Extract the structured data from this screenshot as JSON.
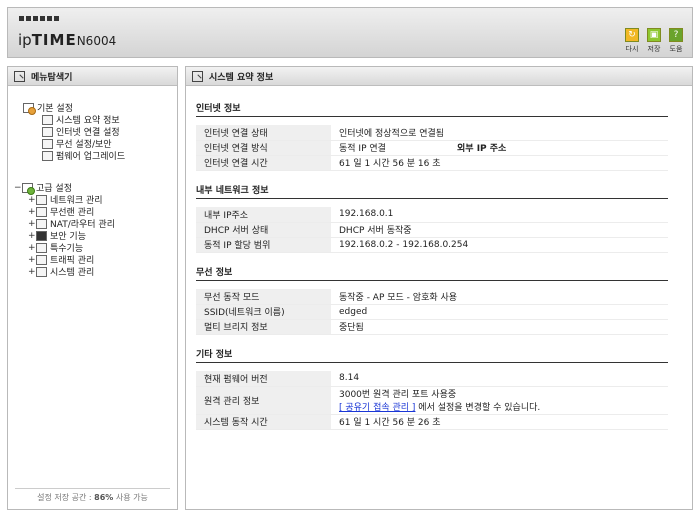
{
  "header": {
    "logo_part1": "ip",
    "logo_part2": "TIME",
    "logo_model": "N6004",
    "buttons": [
      {
        "label": "다시",
        "color": "#f1b825",
        "icon": "refresh-icon"
      },
      {
        "label": "저장",
        "color": "#8ec72f",
        "icon": "save-icon"
      },
      {
        "label": "도움",
        "color": "#6aa32b",
        "icon": "help-icon"
      }
    ]
  },
  "left": {
    "title": "메뉴탐색기",
    "basic": {
      "label": "기본 설정",
      "items": [
        "시스템 요약 정보",
        "인터넷 연결 설정",
        "무선 설정/보안",
        "펌웨어 업그레이드"
      ]
    },
    "advanced": {
      "expander": "−",
      "label": "고급 설정",
      "items": [
        "네트워크 관리",
        "무선랜 관리",
        "NAT/라우터 관리",
        "보안 기능",
        "특수기능",
        "트래픽 관리",
        "시스템 관리"
      ]
    },
    "item_expander": "+",
    "footer_prefix": "설정 저장 공간 : ",
    "footer_value": "86%",
    "footer_suffix": " 사용 가능"
  },
  "right": {
    "title": "시스템 요약 정보",
    "sections": [
      {
        "title": "인터넷 정보",
        "rows": [
          {
            "label": "인터넷 연결 상태",
            "value": "인터넷에 정상적으로 연결됨"
          },
          {
            "label": "인터넷 연결 방식",
            "value": "동적 IP 연결",
            "extra": "외부 IP 주소"
          },
          {
            "label": "인터넷 연결 시간",
            "value": "61 일 1 시간 56 분 16 초"
          }
        ]
      },
      {
        "title": "내부 네트워크 정보",
        "rows": [
          {
            "label": "내부 IP주소",
            "value": "192.168.0.1"
          },
          {
            "label": "DHCP 서버 상태",
            "value": "DHCP 서버 동작중"
          },
          {
            "label": "동적 IP 할당 범위",
            "value": "192.168.0.2 -  192.168.0.254"
          }
        ]
      },
      {
        "title": "무선 정보",
        "rows": [
          {
            "label": "무선 동작 모드",
            "value": "동작중 - AP 모드 - 암호화 사용"
          },
          {
            "label": "SSID(네트워크 이름)",
            "value": "edged"
          },
          {
            "label": "멀티 브리지 정보",
            "value": "중단됨"
          }
        ]
      },
      {
        "title": "기타 정보",
        "rows": [
          {
            "label": "현재 펌웨어 버전",
            "value": "8.14"
          },
          {
            "label": "원격 관리 정보",
            "value": "3000번 원격 관리 포트 사용중",
            "link": "[ 공유기 접속 관리 ]",
            "value2": " 에서 설정을 변경할 수 있습니다."
          },
          {
            "label": "시스템 동작 시간",
            "value": "61 일 1 시간 56 분 26 초"
          }
        ]
      }
    ]
  }
}
